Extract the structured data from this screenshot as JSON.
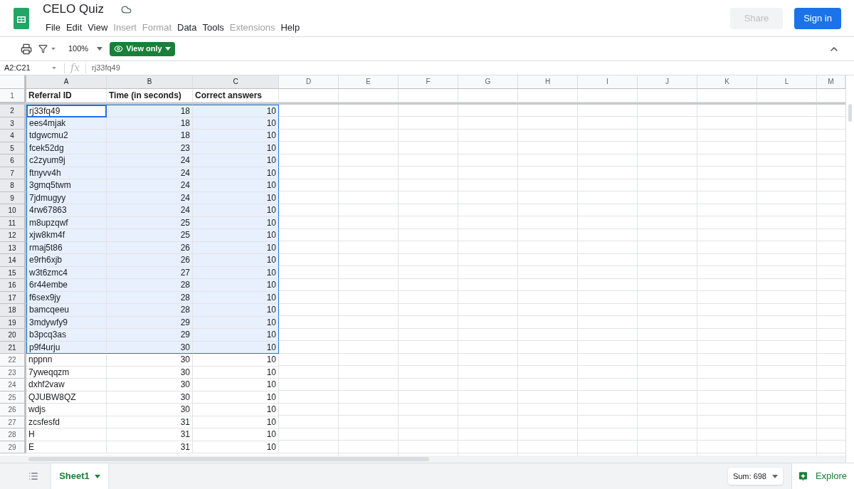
{
  "app": {
    "title": "CELO Quiz",
    "menu": [
      {
        "label": "File",
        "disabled": false
      },
      {
        "label": "Edit",
        "disabled": false
      },
      {
        "label": "View",
        "disabled": false
      },
      {
        "label": "Insert",
        "disabled": true
      },
      {
        "label": "Format",
        "disabled": true
      },
      {
        "label": "Data",
        "disabled": false
      },
      {
        "label": "Tools",
        "disabled": false
      },
      {
        "label": "Extensions",
        "disabled": true
      },
      {
        "label": "Help",
        "disabled": false
      }
    ],
    "share": {
      "label": "Share",
      "disabled": true
    },
    "sign_in": "Sign in"
  },
  "toolbar": {
    "zoom": "100%",
    "mode": "View only"
  },
  "formula_bar": {
    "range": "A2:C21",
    "fx": "fx",
    "value": "rj33fq49"
  },
  "columns": [
    {
      "label": "A",
      "selected": true
    },
    {
      "label": "B",
      "selected": true
    },
    {
      "label": "C",
      "selected": true
    },
    {
      "label": "D",
      "selected": false
    },
    {
      "label": "E",
      "selected": false
    },
    {
      "label": "F",
      "selected": false
    },
    {
      "label": "G",
      "selected": false
    },
    {
      "label": "H",
      "selected": false
    },
    {
      "label": "I",
      "selected": false
    },
    {
      "label": "J",
      "selected": false
    },
    {
      "label": "K",
      "selected": false
    },
    {
      "label": "L",
      "selected": false
    },
    {
      "label": "M",
      "selected": false
    }
  ],
  "header_row": {
    "number": "1",
    "cells": [
      "Referral ID",
      "Time (in seconds)",
      "Correct answers"
    ]
  },
  "rows": [
    {
      "number": "2",
      "cells": [
        "rj33fq49",
        "18",
        "10"
      ],
      "selected": true,
      "active": true
    },
    {
      "number": "3",
      "cells": [
        "ees4mjak",
        "18",
        "10"
      ],
      "selected": true,
      "active": false
    },
    {
      "number": "4",
      "cells": [
        "tdgwcmu2",
        "18",
        "10"
      ],
      "selected": true,
      "active": false
    },
    {
      "number": "5",
      "cells": [
        "fcek52dg",
        "23",
        "10"
      ],
      "selected": true,
      "active": false
    },
    {
      "number": "6",
      "cells": [
        "c2zyum9j",
        "24",
        "10"
      ],
      "selected": true,
      "active": false
    },
    {
      "number": "7",
      "cells": [
        "ftnyvv4h",
        "24",
        "10"
      ],
      "selected": true,
      "active": false
    },
    {
      "number": "8",
      "cells": [
        "3gmq5twm",
        "24",
        "10"
      ],
      "selected": true,
      "active": false
    },
    {
      "number": "9",
      "cells": [
        "7jdmugyy",
        "24",
        "10"
      ],
      "selected": true,
      "active": false
    },
    {
      "number": "10",
      "cells": [
        "4rw67863",
        "24",
        "10"
      ],
      "selected": true,
      "active": false
    },
    {
      "number": "11",
      "cells": [
        "m8upzqwf",
        "25",
        "10"
      ],
      "selected": true,
      "active": false
    },
    {
      "number": "12",
      "cells": [
        "xjw8km4f",
        "25",
        "10"
      ],
      "selected": true,
      "active": false
    },
    {
      "number": "13",
      "cells": [
        "rmaj5t86",
        "26",
        "10"
      ],
      "selected": true,
      "active": false
    },
    {
      "number": "14",
      "cells": [
        "e9rh6xjb",
        "26",
        "10"
      ],
      "selected": true,
      "active": false
    },
    {
      "number": "15",
      "cells": [
        "w3t6zmc4",
        "27",
        "10"
      ],
      "selected": true,
      "active": false
    },
    {
      "number": "16",
      "cells": [
        "6r44embe",
        "28",
        "10"
      ],
      "selected": true,
      "active": false
    },
    {
      "number": "17",
      "cells": [
        "f6sex9jy",
        "28",
        "10"
      ],
      "selected": true,
      "active": false
    },
    {
      "number": "18",
      "cells": [
        "bamcqeeu",
        "28",
        "10"
      ],
      "selected": true,
      "active": false
    },
    {
      "number": "19",
      "cells": [
        "3mdywfy9",
        "29",
        "10"
      ],
      "selected": true,
      "active": false
    },
    {
      "number": "20",
      "cells": [
        "b3pcq3as",
        "29",
        "10"
      ],
      "selected": true,
      "active": false
    },
    {
      "number": "21",
      "cells": [
        "p9f4urju",
        "30",
        "10"
      ],
      "selected": true,
      "active": false
    },
    {
      "number": "22",
      "cells": [
        "nppnn",
        "30",
        "10"
      ],
      "selected": false,
      "active": false
    },
    {
      "number": "23",
      "cells": [
        "7yweqqzm",
        "30",
        "10"
      ],
      "selected": false,
      "active": false
    },
    {
      "number": "24",
      "cells": [
        "dxhf2vaw",
        "30",
        "10"
      ],
      "selected": false,
      "active": false
    },
    {
      "number": "25",
      "cells": [
        "QJUBW8QZ",
        "30",
        "10"
      ],
      "selected": false,
      "active": false
    },
    {
      "number": "26",
      "cells": [
        "wdjs",
        "30",
        "10"
      ],
      "selected": false,
      "active": false
    },
    {
      "number": "27",
      "cells": [
        "zcsfesfd",
        "31",
        "10"
      ],
      "selected": false,
      "active": false
    },
    {
      "number": "28",
      "cells": [
        "H",
        "31",
        "10"
      ],
      "selected": false,
      "active": false
    },
    {
      "number": "29",
      "cells": [
        "E",
        "31",
        "10"
      ],
      "selected": false,
      "active": false
    }
  ],
  "sheet_tabs": [
    {
      "label": "Sheet1",
      "selected": true
    }
  ],
  "status": {
    "sum": "Sum: 698",
    "explore": "Explore"
  }
}
